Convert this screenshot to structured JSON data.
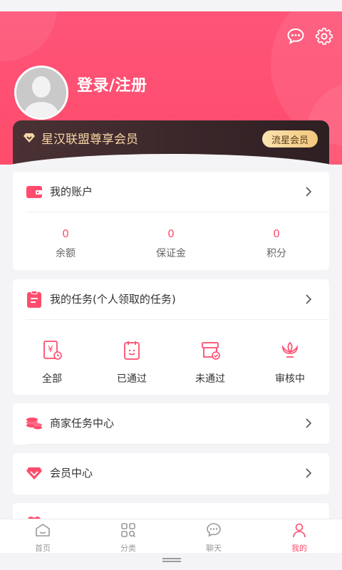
{
  "header": {
    "login_text": "登录/注册",
    "icons": [
      "message-icon",
      "gear-icon"
    ]
  },
  "vip": {
    "title": "星汉联盟尊享会员",
    "badge": "流星会员"
  },
  "account": {
    "title": "我的账户",
    "stats": [
      {
        "value": "0",
        "label": "余额"
      },
      {
        "value": "0",
        "label": "保证金"
      },
      {
        "value": "0",
        "label": "积分"
      }
    ]
  },
  "tasks": {
    "title": "我的任务(个人领取的任务)",
    "items": [
      {
        "label": "全部",
        "icon": "money-doc-icon"
      },
      {
        "label": "已通过",
        "icon": "approved-icon"
      },
      {
        "label": "未通过",
        "icon": "rejected-icon"
      },
      {
        "label": "审核中",
        "icon": "lotus-icon"
      }
    ]
  },
  "menu": {
    "merchant": "商家任务中心",
    "member": "会员中心"
  },
  "tabs": [
    {
      "label": "首页",
      "icon": "home-icon"
    },
    {
      "label": "分类",
      "icon": "category-icon"
    },
    {
      "label": "聊天",
      "icon": "chat-icon"
    },
    {
      "label": "我的",
      "icon": "user-icon",
      "active": true
    }
  ],
  "colors": {
    "accent": "#ff4c6c",
    "vip_text": "#f5d6a4",
    "vip_bg": "#2e1f22"
  }
}
